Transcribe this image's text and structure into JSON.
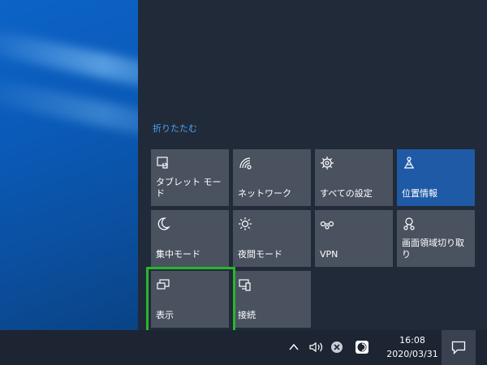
{
  "action_center": {
    "collapse_label": "折りたたむ",
    "tiles": [
      {
        "label": "タブレット モード",
        "icon": "tablet-mode-icon",
        "active": false
      },
      {
        "label": "ネットワーク",
        "icon": "network-icon",
        "active": false
      },
      {
        "label": "すべての設定",
        "icon": "gear-icon",
        "active": false
      },
      {
        "label": "位置情報",
        "icon": "location-icon",
        "active": true
      },
      {
        "label": "集中モード",
        "icon": "moon-icon",
        "active": false
      },
      {
        "label": "夜間モード",
        "icon": "brightness-icon",
        "active": false
      },
      {
        "label": "VPN",
        "icon": "vpn-icon",
        "active": false
      },
      {
        "label": "画面領域切り取り",
        "icon": "snip-icon",
        "active": false
      },
      {
        "label": "表示",
        "icon": "project-icon",
        "active": false
      },
      {
        "label": "接続",
        "icon": "connect-icon",
        "active": false
      }
    ]
  },
  "taskbar": {
    "time": "16:08",
    "date": "2020/03/31",
    "tray_icons": [
      "chevron-up-icon",
      "speaker-icon",
      "close-circle-icon",
      "app-icon"
    ],
    "notification_icon": "notification-icon"
  },
  "colors": {
    "accent": "#1f5aa6",
    "highlight_border": "#26b82b",
    "link": "#4ea3f0"
  }
}
